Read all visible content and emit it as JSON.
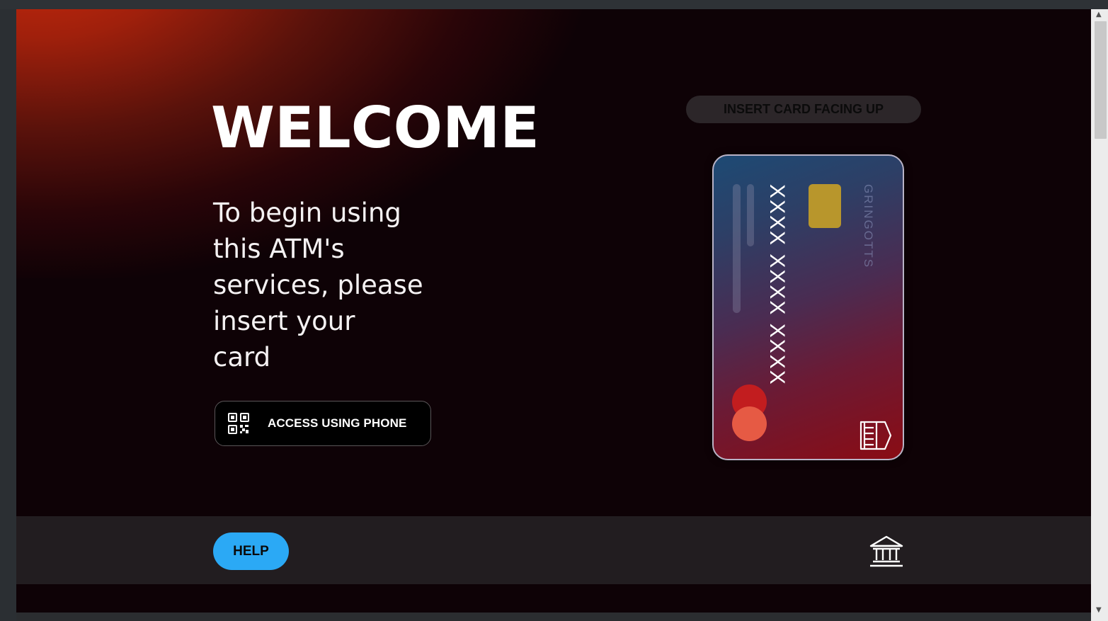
{
  "hero": {
    "title": "WELCOME",
    "intro_lines": [
      "To begin using",
      "this ATM's",
      "services, please",
      "insert your",
      "card"
    ]
  },
  "phone_access": {
    "label": "ACCESS USING PHONE",
    "icon": "qr-code-icon"
  },
  "card_prompt": {
    "label": "INSERT CARD FACING UP"
  },
  "card": {
    "number": "XXXX  XXXX  XXXX",
    "brand": "GRINGOTTS",
    "chip_color": "#b8962c",
    "logo_colors": [
      "#c21d1f",
      "#e65a44"
    ],
    "icon": "contactless-icon"
  },
  "footer": {
    "help_label": "HELP",
    "bank_icon": "bank-icon"
  },
  "colors": {
    "background": "#0e0206",
    "accent_glow": "#c8290b",
    "help_button": "#2ba9f5",
    "footer": "#221d20"
  }
}
